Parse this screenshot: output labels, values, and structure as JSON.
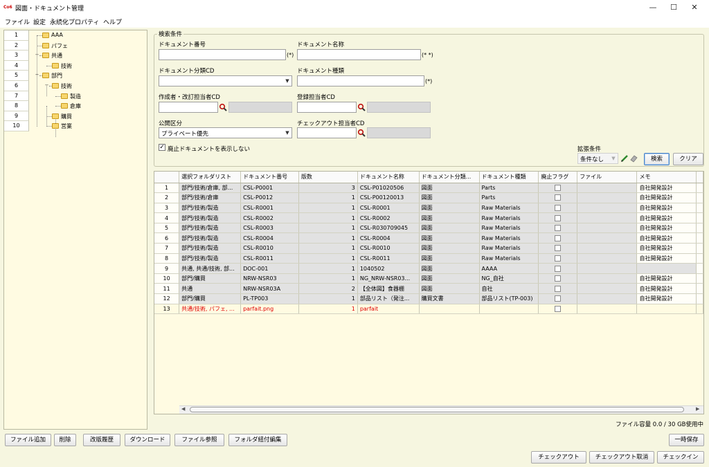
{
  "window": {
    "title": "図面・ドキュメント管理",
    "icon_text": "Co6",
    "controls": {
      "minimize": "—",
      "maximize": "☐",
      "close": "✕"
    }
  },
  "menu": [
    "ファイル",
    "設定",
    "永続化プロパティ",
    "ヘルプ"
  ],
  "tree": {
    "rows": [
      {
        "num": "1",
        "label": "AAA"
      },
      {
        "num": "2",
        "label": "パフェ"
      },
      {
        "num": "3",
        "label": "共通"
      },
      {
        "num": "4",
        "label": "技術"
      },
      {
        "num": "5",
        "label": "部門"
      },
      {
        "num": "6",
        "label": "技術"
      },
      {
        "num": "7",
        "label": "製造"
      },
      {
        "num": "8",
        "label": "倉庫"
      },
      {
        "num": "9",
        "label": "購買"
      },
      {
        "num": "10",
        "label": "営業"
      }
    ]
  },
  "search": {
    "legend": "検索条件",
    "doc_number_label": "ドキュメント番号",
    "doc_number_value": "",
    "doc_number_note": "(*)",
    "doc_name_label": "ドキュメント名称",
    "doc_name_value": "",
    "doc_name_note": "(* *)",
    "doc_class_label": "ドキュメント分類CD",
    "doc_class_value": "",
    "doc_type_label": "ドキュメント種類",
    "doc_type_value": "",
    "doc_type_note": "(*)",
    "author_label": "作成者・改訂担当者CD",
    "author_value": "",
    "registrant_label": "登録担当者CD",
    "registrant_value": "",
    "visibility_label": "公開区分",
    "visibility_value": "プライベート優先",
    "checkout_label": "チェックアウト担当者CD",
    "checkout_value": "",
    "hide_obsolete_label": "廃止ドキュメントを表示しない",
    "hide_obsolete_checked": "✓",
    "ext_label": "拡張条件",
    "ext_value": "条件なし",
    "search_button": "検索",
    "clear_button": "クリア"
  },
  "grid": {
    "columns": [
      "",
      "選択フォルダリスト",
      "ドキュメント番号",
      "版数",
      "ドキュメント名称",
      "ドキュメント分類...",
      "ドキュメント種類",
      "廃止フラグ",
      "ファイル",
      "メモ"
    ],
    "rows": [
      {
        "n": "1",
        "folder": "部門/技術/倉庫, 部...",
        "num": "CSL-P0001",
        "rev": "3",
        "name": "CSL-P01020506",
        "cls": "図面",
        "type": "Parts",
        "file": "",
        "memo": "自社開発設計"
      },
      {
        "n": "2",
        "folder": "部門/技術/倉庫",
        "num": "CSL-P0012",
        "rev": "1",
        "name": "CSL-P00120013",
        "cls": "図面",
        "type": "Parts",
        "file": "",
        "memo": "自社開発設計"
      },
      {
        "n": "3",
        "folder": "部門/技術/製造",
        "num": "CSL-R0001",
        "rev": "1",
        "name": "CSL-R0001",
        "cls": "図面",
        "type": "Raw Materials",
        "file": "",
        "memo": "自社開発設計"
      },
      {
        "n": "4",
        "folder": "部門/技術/製造",
        "num": "CSL-R0002",
        "rev": "1",
        "name": "CSL-R0002",
        "cls": "図面",
        "type": "Raw Materials",
        "file": "",
        "memo": "自社開発設計"
      },
      {
        "n": "5",
        "folder": "部門/技術/製造",
        "num": "CSL-R0003",
        "rev": "1",
        "name": "CSL-R030709045",
        "cls": "図面",
        "type": "Raw Materials",
        "file": "",
        "memo": "自社開発設計"
      },
      {
        "n": "6",
        "folder": "部門/技術/製造",
        "num": "CSL-R0004",
        "rev": "1",
        "name": "CSL-R0004",
        "cls": "図面",
        "type": "Raw Materials",
        "file": "",
        "memo": "自社開発設計"
      },
      {
        "n": "7",
        "folder": "部門/技術/製造",
        "num": "CSL-R0010",
        "rev": "1",
        "name": "CSL-R0010",
        "cls": "図面",
        "type": "Raw Materials",
        "file": "",
        "memo": "自社開発設計"
      },
      {
        "n": "8",
        "folder": "部門/技術/製造",
        "num": "CSL-R0011",
        "rev": "1",
        "name": "CSL-R0011",
        "cls": "図面",
        "type": "Raw Materials",
        "file": "",
        "memo": "自社開発設計"
      },
      {
        "n": "9",
        "folder": "共通, 共通/技術, 部...",
        "num": "DOC-001",
        "rev": "1",
        "name": "1040502",
        "cls": "図面",
        "type": "AAAA",
        "file": "",
        "memo": ""
      },
      {
        "n": "10",
        "folder": "部門/購買",
        "num": "NRW-NSR03",
        "rev": "1",
        "name": "NG_NRW-NSR03...",
        "cls": "図面",
        "type": "NG_自社",
        "file": "",
        "memo": "自社開発設計"
      },
      {
        "n": "11",
        "folder": "共通",
        "num": "NRW-NSR03A",
        "rev": "2",
        "name": "【全体図】食器棚",
        "cls": "図面",
        "type": "自社",
        "file": "",
        "memo": "自社開発設計"
      },
      {
        "n": "12",
        "folder": "部門/購買",
        "num": "PL-TP003",
        "rev": "1",
        "name": "部品リスト（発注...",
        "cls": "購買文書",
        "type": "部品リスト(TP-003)",
        "file": "",
        "memo": "自社開発設計"
      },
      {
        "n": "13",
        "folder": "共通/技術, パフェ, ...",
        "num": "parfait.png",
        "rev": "1",
        "name": "parfait",
        "cls": "",
        "type": "",
        "file": "",
        "memo": ""
      }
    ]
  },
  "status": {
    "capacity": "ファイル容量 0.0 / 30 GB使用中"
  },
  "bottom_buttons": {
    "add_file": "ファイル追加",
    "delete": "削除",
    "history": "改版履歴",
    "download": "ダウンロード",
    "file_ref": "ファイル参照",
    "folder_edit": "フォルダ紐付編集",
    "temp_save": "一時保存",
    "checkout": "チェックアウト",
    "checkout_cancel": "チェックアウト取消",
    "checkin": "チェックイン"
  }
}
